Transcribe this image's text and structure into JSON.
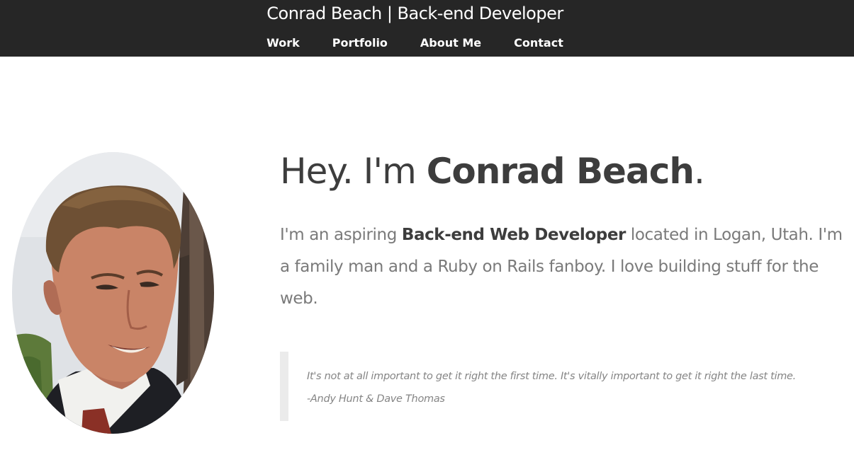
{
  "header": {
    "site_title": "Conrad Beach | Back-end Developer",
    "background_color": "#262626",
    "nav": [
      {
        "label": "Work"
      },
      {
        "label": "Portfolio"
      },
      {
        "label": "About Me"
      },
      {
        "label": "Contact"
      }
    ]
  },
  "hero": {
    "headline_prefix": "Hey. I'm ",
    "headline_name": "Conrad Beach",
    "headline_suffix": ".",
    "intro_prefix": "I'm an aspiring ",
    "intro_role": "Back-end Web Developer",
    "intro_suffix": " located in Logan, Utah. I'm a family man and a Ruby on Rails fanboy. I love building stuff for the web.",
    "quote_text": "It's not at all important to get it right the first time. It's vitally important to get it right the last time.",
    "quote_author": "-Andy Hunt & Dave Thomas"
  }
}
